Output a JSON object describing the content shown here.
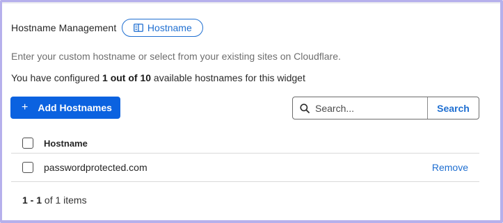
{
  "header": {
    "title": "Hostname Management",
    "chip_label": "Hostname"
  },
  "description": "Enter your custom hostname or select from your existing sites on Cloudflare.",
  "quota": {
    "prefix": "You have configured ",
    "count_text": "1 out of 10",
    "suffix": " available hostnames for this widget"
  },
  "actions": {
    "add_label": "Add Hostnames",
    "search_placeholder": "Search...",
    "search_value": "",
    "search_button": "Search"
  },
  "table": {
    "column_header": "Hostname",
    "rows": [
      {
        "hostname": "passwordprotected.com",
        "action": "Remove"
      }
    ]
  },
  "pagination": {
    "range": "1 - 1",
    "of_text": " of 1 items"
  },
  "colors": {
    "accent": "#1f6fd1",
    "primary_button": "#0b62e0",
    "frame_border": "#b6b0ec"
  },
  "icons": {
    "chip": "book-open-icon",
    "add": "plus-icon",
    "search": "search-icon"
  }
}
